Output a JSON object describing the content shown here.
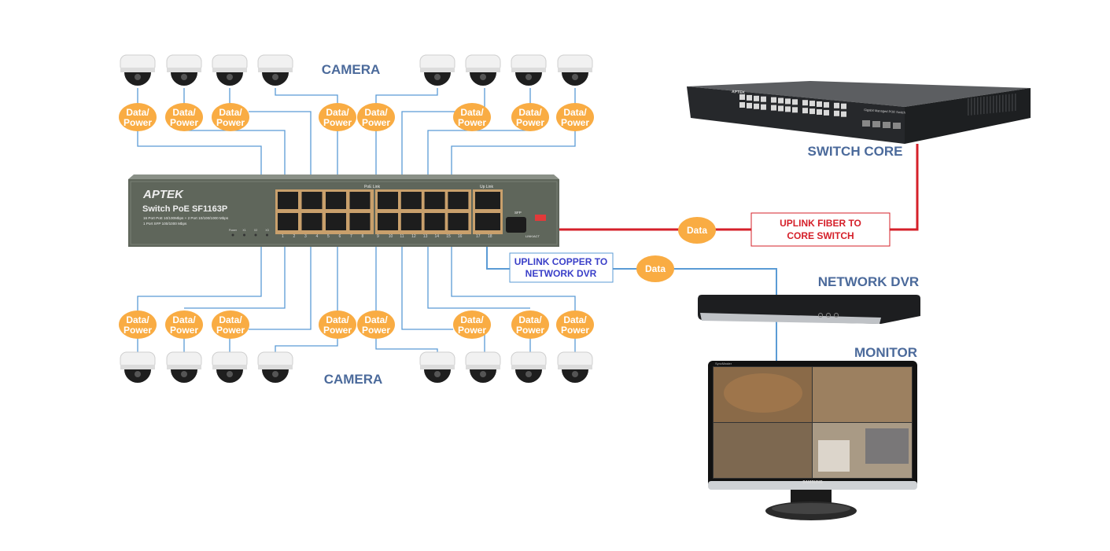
{
  "labels": {
    "camera_top": "CAMERA",
    "camera_bottom": "CAMERA",
    "switch_core": "SWITCH CORE",
    "network_dvr": "NETWORK DVR",
    "monitor": "MONITOR"
  },
  "poe_bubble": {
    "line1": "Data/",
    "line2": "Power",
    "count_top": 8,
    "count_bottom": 8
  },
  "data_bubbles": {
    "fiber": "Data",
    "copper": "Data"
  },
  "uplink_fiber_box": {
    "line1": "UPLINK FIBER TO",
    "line2": "CORE SWITCH"
  },
  "uplink_copper_box": {
    "line1": "UPLINK COPPER TO",
    "line2": "NETWORK DVR"
  },
  "poe_switch": {
    "brand": "APTEK",
    "model": "Switch PoE SF1163P",
    "spec_line1": "16 Port PoE 10/100Mbps + 2 Port 10/100/1000 Mbps",
    "spec_line2": "1 Port SFP 100/1000 Mbps",
    "poe_link_label": "PoE Link",
    "up_link_label": "Up Link",
    "sfp_label": "SFP",
    "link_act_label": "LINK/ACT",
    "led_labels": [
      "Power",
      "X1",
      "X2",
      "X3"
    ],
    "port_labels": [
      "1",
      "2",
      "3",
      "4",
      "5",
      "6",
      "7",
      "8",
      "9",
      "10",
      "11",
      "12",
      "13",
      "14",
      "15",
      "16",
      "17",
      "18"
    ]
  },
  "core_switch": {
    "brand": "APTEK",
    "caption": "Gigabit Managed POE Switch"
  },
  "monitor": {
    "brand": "SAMSUNG",
    "model": "SyncMaster"
  },
  "colors": {
    "label": "#4b6a9b",
    "bubble": "#f9ac43",
    "copper_line": "#5b9bd5",
    "fiber_line": "#d5202a",
    "copper_box_text": "#3a3fc8",
    "fiber_box_text": "#d5202a"
  }
}
